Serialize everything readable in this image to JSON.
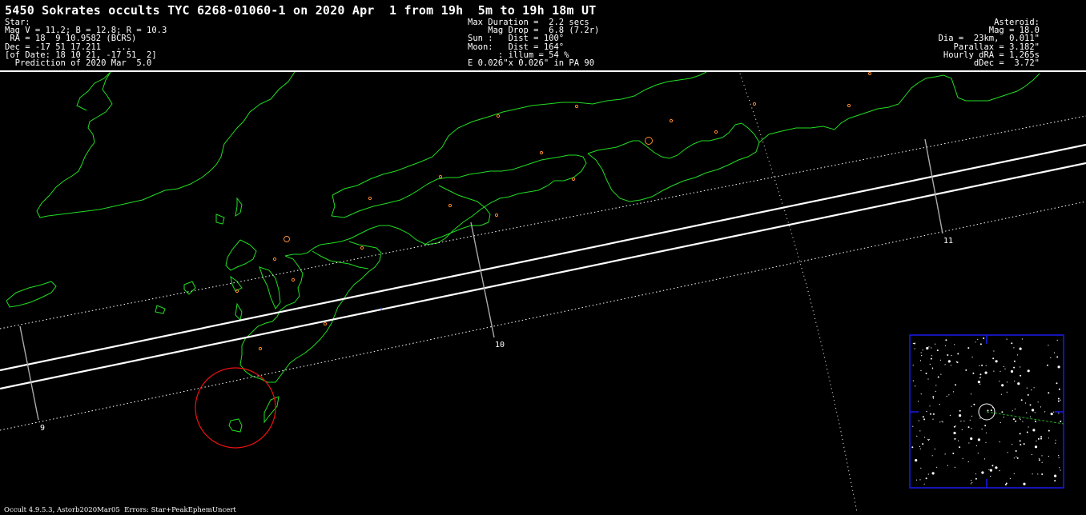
{
  "title": "5450 Sokrates occults TYC 6268-01060-1 on 2020 Apr  1 from 19h  5m to 19h 18m UT",
  "star": {
    "lines": [
      "Star:",
      "Mag V = 11.2; B = 12.8; R = 10.3",
      " RA = 18  9 10.9582 (BCRS)",
      "Dec = -17 51 17.211   ...",
      "[of Date: 18 10 21, -17 51  2]",
      "  Prediction of 2020 Mar  5.0"
    ]
  },
  "event": {
    "lines": [
      "Max Duration =  2.2 secs",
      "    Mag Drop =  6.8 (7.2r)",
      "Sun :   Dist = 100°",
      "Moon:   Dist = 164°",
      "      : illum = 54 %",
      "E 0.026\"x 0.026\" in PA 90"
    ]
  },
  "asteroid": {
    "lines": [
      "Asteroid:",
      "Mag = 18.0",
      "Dia =  23km,  0.011\"",
      "Parallax = 3.182\"",
      "Hourly dRA = 1.265s",
      "dDec =  3.72\""
    ]
  },
  "time_marks": [
    "9",
    "10",
    "11"
  ],
  "footer": "Occult 4.9.5.3, Astorb2020Mar05  Errors: Star+PeakEphemUncert",
  "colors": {
    "background": "#000000",
    "coastline": "#22dd22",
    "path": "#ffffff",
    "city": "#ff8a2a",
    "moon_circle": "#ee1111",
    "finder_border": "#1a1aee",
    "tick": "#aaaaaa"
  }
}
